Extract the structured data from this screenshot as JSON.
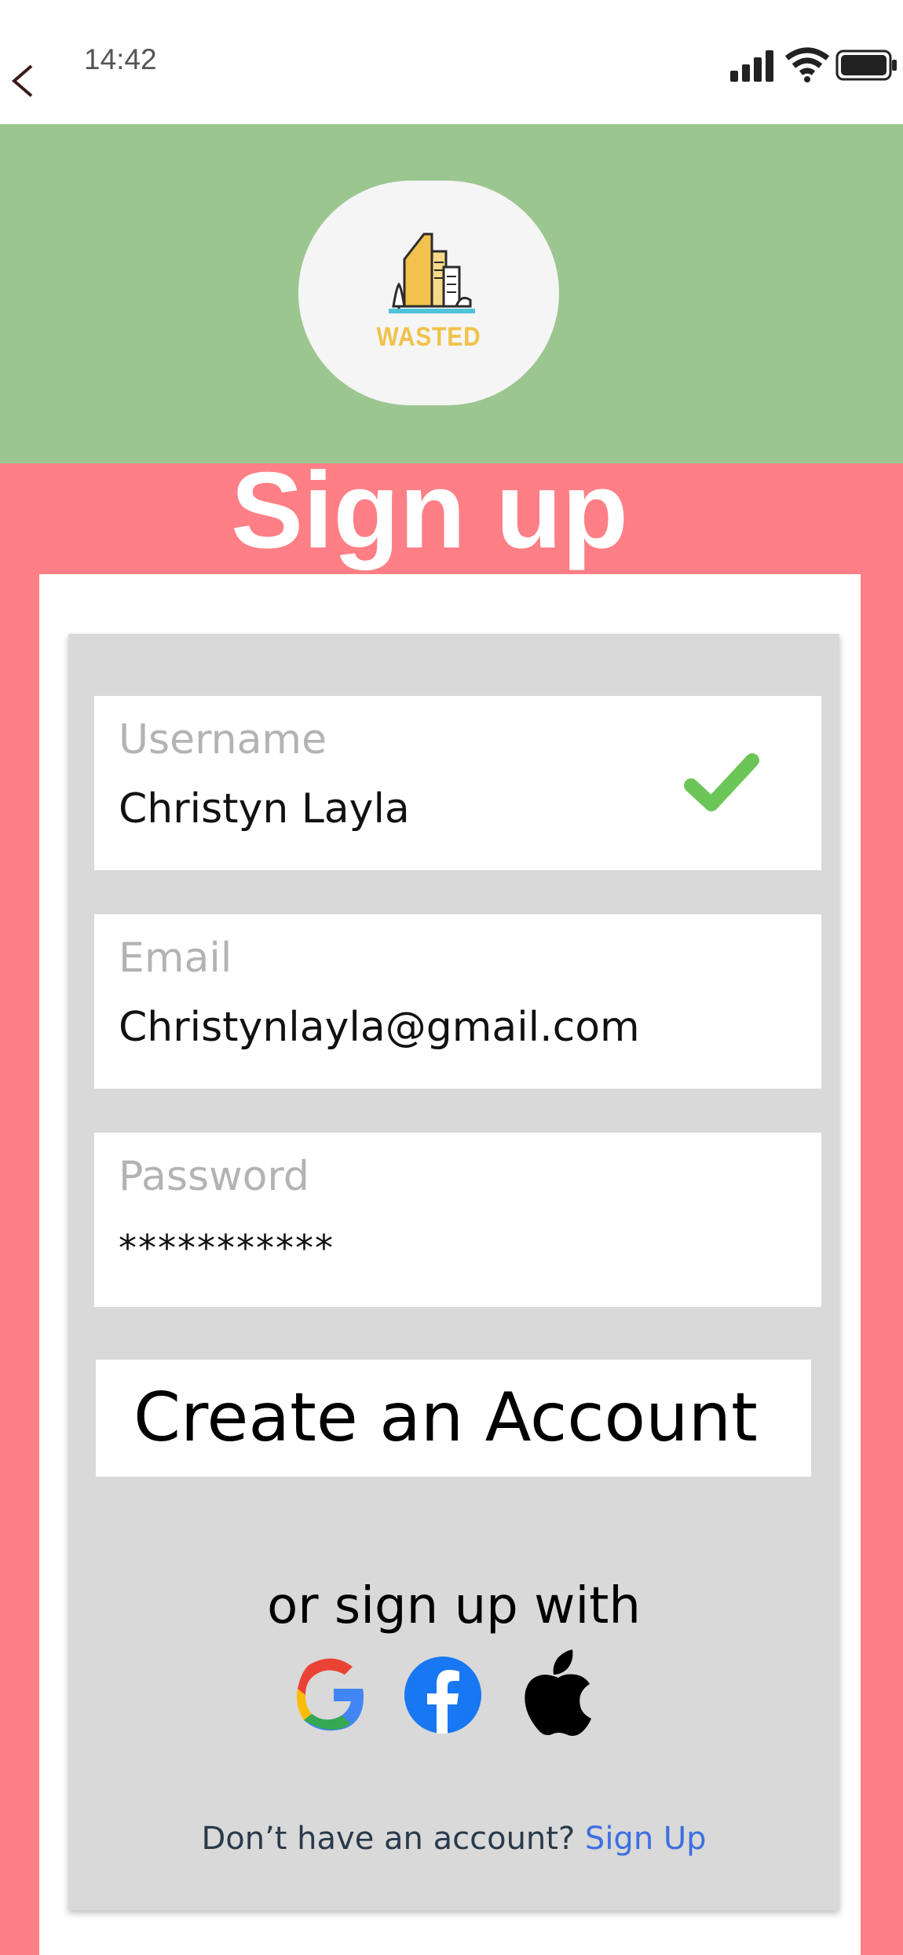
{
  "status_bar": {
    "time": "14:42"
  },
  "logo": {
    "text": "WASTED",
    "color": "#f0c24a"
  },
  "page": {
    "title": "Sign up"
  },
  "form": {
    "username": {
      "label": "Username",
      "value": "Christyn Layla",
      "valid": true
    },
    "email": {
      "label": "Email",
      "value": "Christynlayla@gmail.com"
    },
    "password": {
      "label": "Password",
      "value": "***********"
    },
    "submit_label": "Create an Account"
  },
  "social": {
    "prompt": "or sign up with",
    "providers": [
      "google-icon",
      "facebook-icon",
      "apple-icon"
    ]
  },
  "footer": {
    "question": "Don’t have an account?",
    "link": "Sign Up"
  },
  "colors": {
    "header_green": "#9bc690",
    "background_pink": "#ff7f86",
    "panel_grey": "#d9d9d9",
    "check_green": "#6cc657",
    "link_blue": "#3c6fe0"
  }
}
